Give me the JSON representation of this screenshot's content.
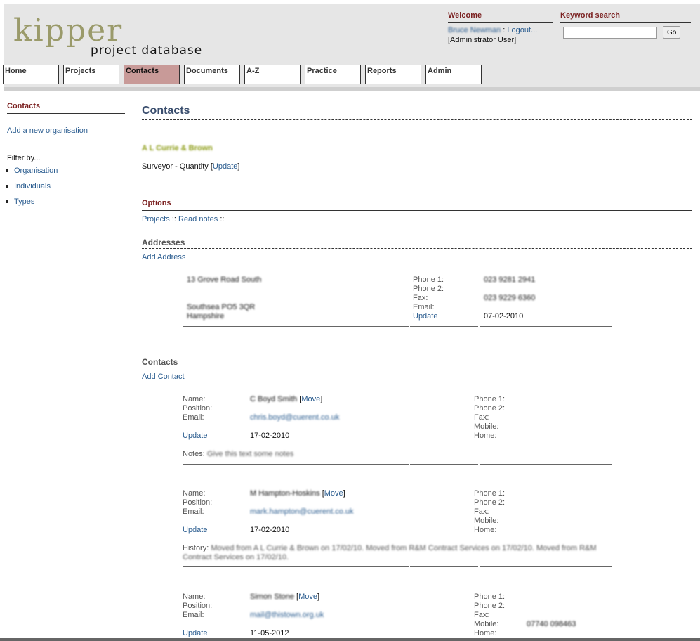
{
  "header": {
    "logo_word": "kipper",
    "logo_sub": "project database",
    "welcome_title": "Welcome",
    "user_name": "Bruce Newman",
    "logout": "Logout...",
    "role": "[Administrator User]",
    "search_title": "Keyword search",
    "search_value": "",
    "go_label": "Go"
  },
  "tabs": [
    "Home",
    "Projects",
    "Contacts",
    "Documents",
    "A-Z",
    "Practice",
    "Reports",
    "Admin"
  ],
  "active_tab": "Contacts",
  "sidebar": {
    "title": "Contacts",
    "add_org": "Add a new organisation",
    "filter_label": "Filter by...",
    "filters": [
      "Organisation",
      "Individuals",
      "Types"
    ]
  },
  "main": {
    "page_title": "Contacts",
    "org_name": "A L Currie & Brown",
    "org_type": "Surveyor - Quantity",
    "update": "Update",
    "options_title": "Options",
    "option_projects": "Projects",
    "option_notes": "Read notes",
    "addresses_title": "Addresses",
    "add_address": "Add Address",
    "address": {
      "line1": "13 Grove Road South",
      "line2": "Southsea PO5 3QR",
      "line3": "Hampshire",
      "labels": [
        "Phone 1:",
        "Phone 2:",
        "Fax:",
        "Email:"
      ],
      "phone1": "023 9281 2941",
      "fax": "023 9229 6360",
      "date": "07-02-2010"
    },
    "contacts_title": "Contacts",
    "add_contact": "Add Contact",
    "left_labels": [
      "Name:",
      "Position:",
      "Email:"
    ],
    "right_labels": [
      "Phone 1:",
      "Phone 2:",
      "Fax:",
      "Mobile:",
      "Home:"
    ],
    "move_label": "Move",
    "contacts": [
      {
        "name": "C Boyd Smith",
        "email": "chris.boyd@cuerent.co.uk",
        "date": "17-02-2010",
        "extra_label": "Notes:",
        "extra_text": "Give this text some notes",
        "mobile": ""
      },
      {
        "name": "M Hampton-Hoskins",
        "email": "mark.hampton@cuerent.co.uk",
        "date": "17-02-2010",
        "extra_label": "History:",
        "extra_text": "Moved from A L Currie & Brown on 17/02/10. Moved from R&M Contract Services on 17/02/10. Moved from R&M Contract Services on 17/02/10.",
        "mobile": ""
      },
      {
        "name": "Simon Stone",
        "email": "mail@thistown.org.uk",
        "date": "11-05-2012",
        "extra_label": "",
        "extra_text": "",
        "mobile": "07740 098463"
      }
    ]
  }
}
